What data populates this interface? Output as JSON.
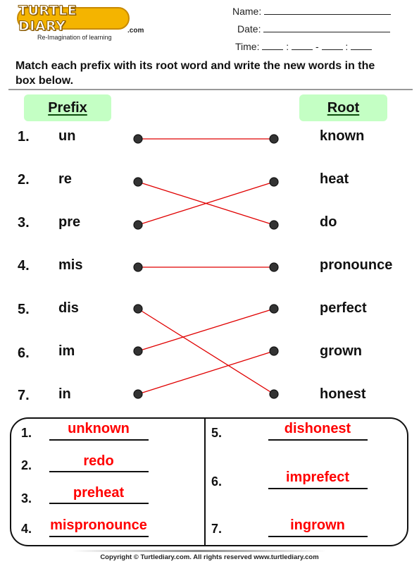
{
  "header": {
    "logo_text": "TURTLE DIARY",
    "logo_domain": ".com",
    "tagline": "Re-Imagination of learning",
    "name_label": "Name:",
    "date_label": "Date:",
    "time_label": "Time:",
    "time_sep_colon": ":",
    "time_sep_dash": "-"
  },
  "instructions": "Match each prefix with its root word and write the new words in the box below.",
  "columns": {
    "prefix_header": "Prefix",
    "root_header": "Root"
  },
  "rows": [
    {
      "num": "1.",
      "prefix": "un",
      "root": "known"
    },
    {
      "num": "2.",
      "prefix": "re",
      "root": "heat"
    },
    {
      "num": "3.",
      "prefix": "pre",
      "root": "do"
    },
    {
      "num": "4.",
      "prefix": "mis",
      "root": "pronounce"
    },
    {
      "num": "5.",
      "prefix": "dis",
      "root": "perfect"
    },
    {
      "num": "6.",
      "prefix": "im",
      "root": "grown"
    },
    {
      "num": "7.",
      "prefix": "in",
      "root": "honest"
    }
  ],
  "matches": [
    {
      "prefix_index": 1,
      "root_index": 1
    },
    {
      "prefix_index": 2,
      "root_index": 3
    },
    {
      "prefix_index": 3,
      "root_index": 2
    },
    {
      "prefix_index": 4,
      "root_index": 4
    },
    {
      "prefix_index": 5,
      "root_index": 7
    },
    {
      "prefix_index": 6,
      "root_index": 5
    },
    {
      "prefix_index": 7,
      "root_index": 6
    }
  ],
  "answers": [
    {
      "num": "1.",
      "word": "unknown"
    },
    {
      "num": "2.",
      "word": "redo"
    },
    {
      "num": "3.",
      "word": "preheat"
    },
    {
      "num": "4.",
      "word": "mispronounce"
    },
    {
      "num": "5.",
      "word": "dishonest"
    },
    {
      "num": "6.",
      "word": "imprefect"
    },
    {
      "num": "7.",
      "word": "ingrown"
    }
  ],
  "colors": {
    "header_box": "#c4ffc4",
    "match_line": "#e00000",
    "answer_text": "#ff0000",
    "dot": "#333333",
    "logo": "#f4b400"
  },
  "footer": "Copyright © Turtlediary.com. All rights reserved  www.turtlediary.com"
}
